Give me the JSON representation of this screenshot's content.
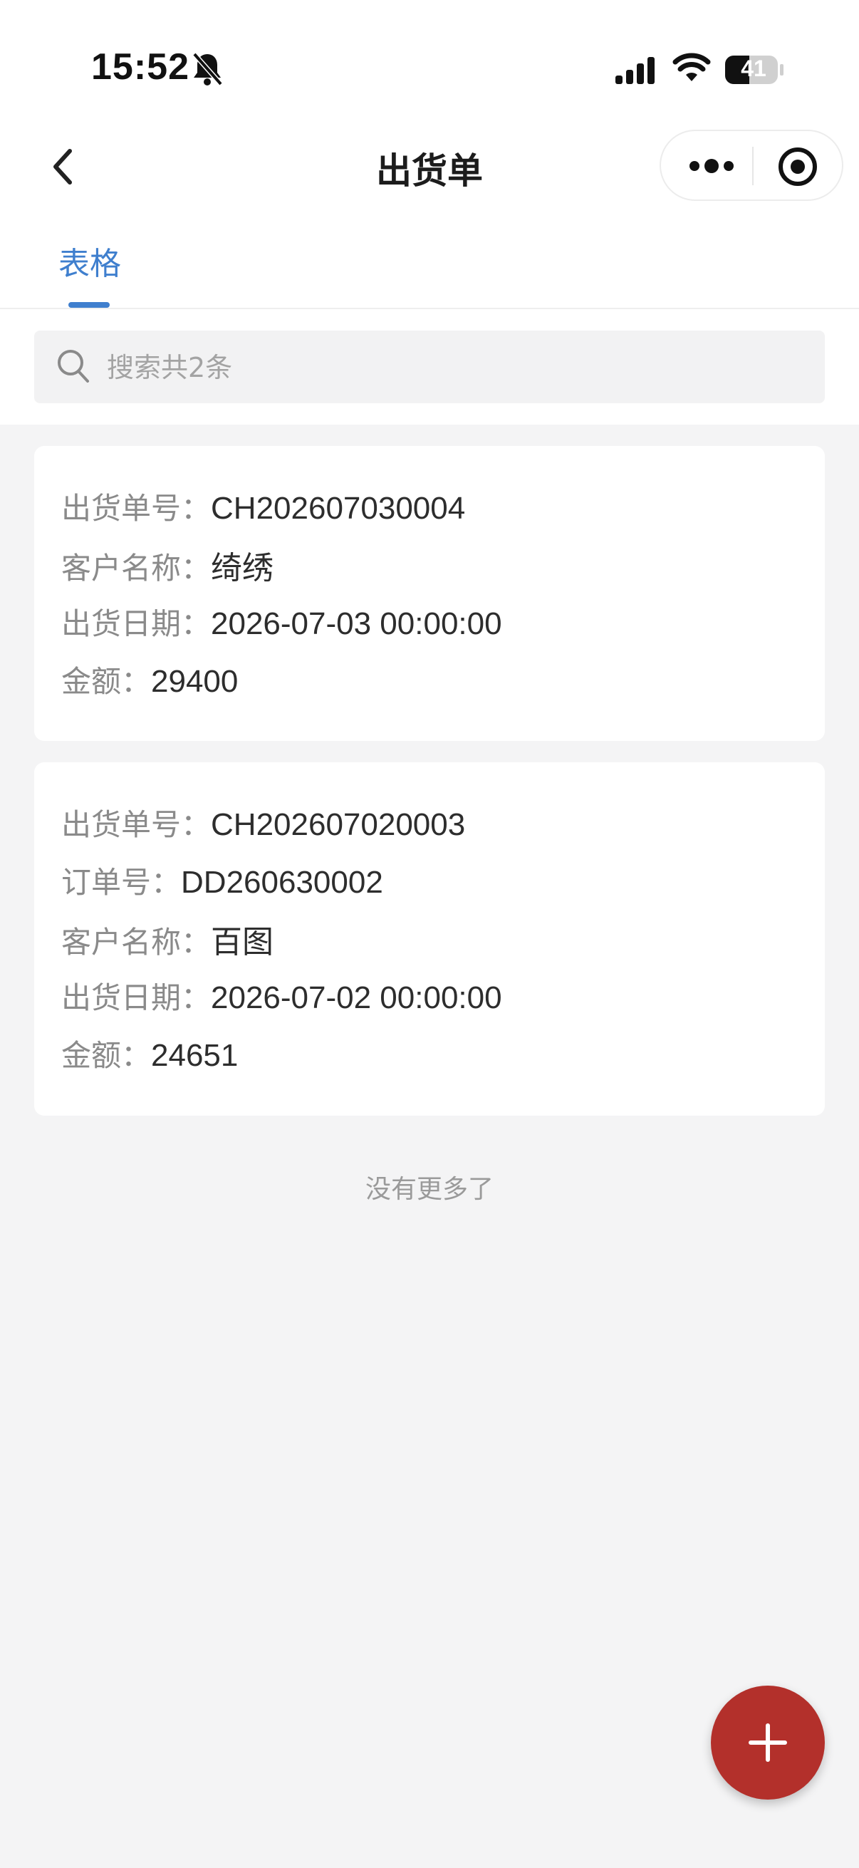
{
  "status_bar": {
    "time": "15:52",
    "battery": "41",
    "icons": [
      "bell-slash-icon",
      "signal-icon",
      "wifi-icon",
      "battery-icon"
    ]
  },
  "nav": {
    "title": "出货单",
    "icons": [
      "chevron-left-icon",
      "more-dots-icon",
      "target-icon"
    ]
  },
  "tabs": [
    {
      "label": "表格",
      "active": true
    }
  ],
  "search": {
    "placeholder": "搜索共2条",
    "value": ""
  },
  "records": [
    {
      "fields": [
        {
          "label": "出货单号：",
          "value": "CH202607030004"
        },
        {
          "label": "客户名称：",
          "value": "绮绣"
        },
        {
          "label": "出货日期：",
          "value": "2026-07-03 00:00:00"
        },
        {
          "label": "金额：",
          "value": "29400"
        }
      ]
    },
    {
      "fields": [
        {
          "label": "出货单号：",
          "value": "CH202607020003"
        },
        {
          "label": "订单号：",
          "value": "DD260630002"
        },
        {
          "label": "客户名称：",
          "value": "百图"
        },
        {
          "label": "出货日期：",
          "value": "2026-07-02 00:00:00"
        },
        {
          "label": "金额：",
          "value": "24651"
        }
      ]
    }
  ],
  "list_end_text": "没有更多了",
  "colors": {
    "accent": "#3f7fce",
    "fab": "#b3302b",
    "background": "#f4f4f5"
  },
  "fab": {
    "icon": "plus-icon"
  }
}
